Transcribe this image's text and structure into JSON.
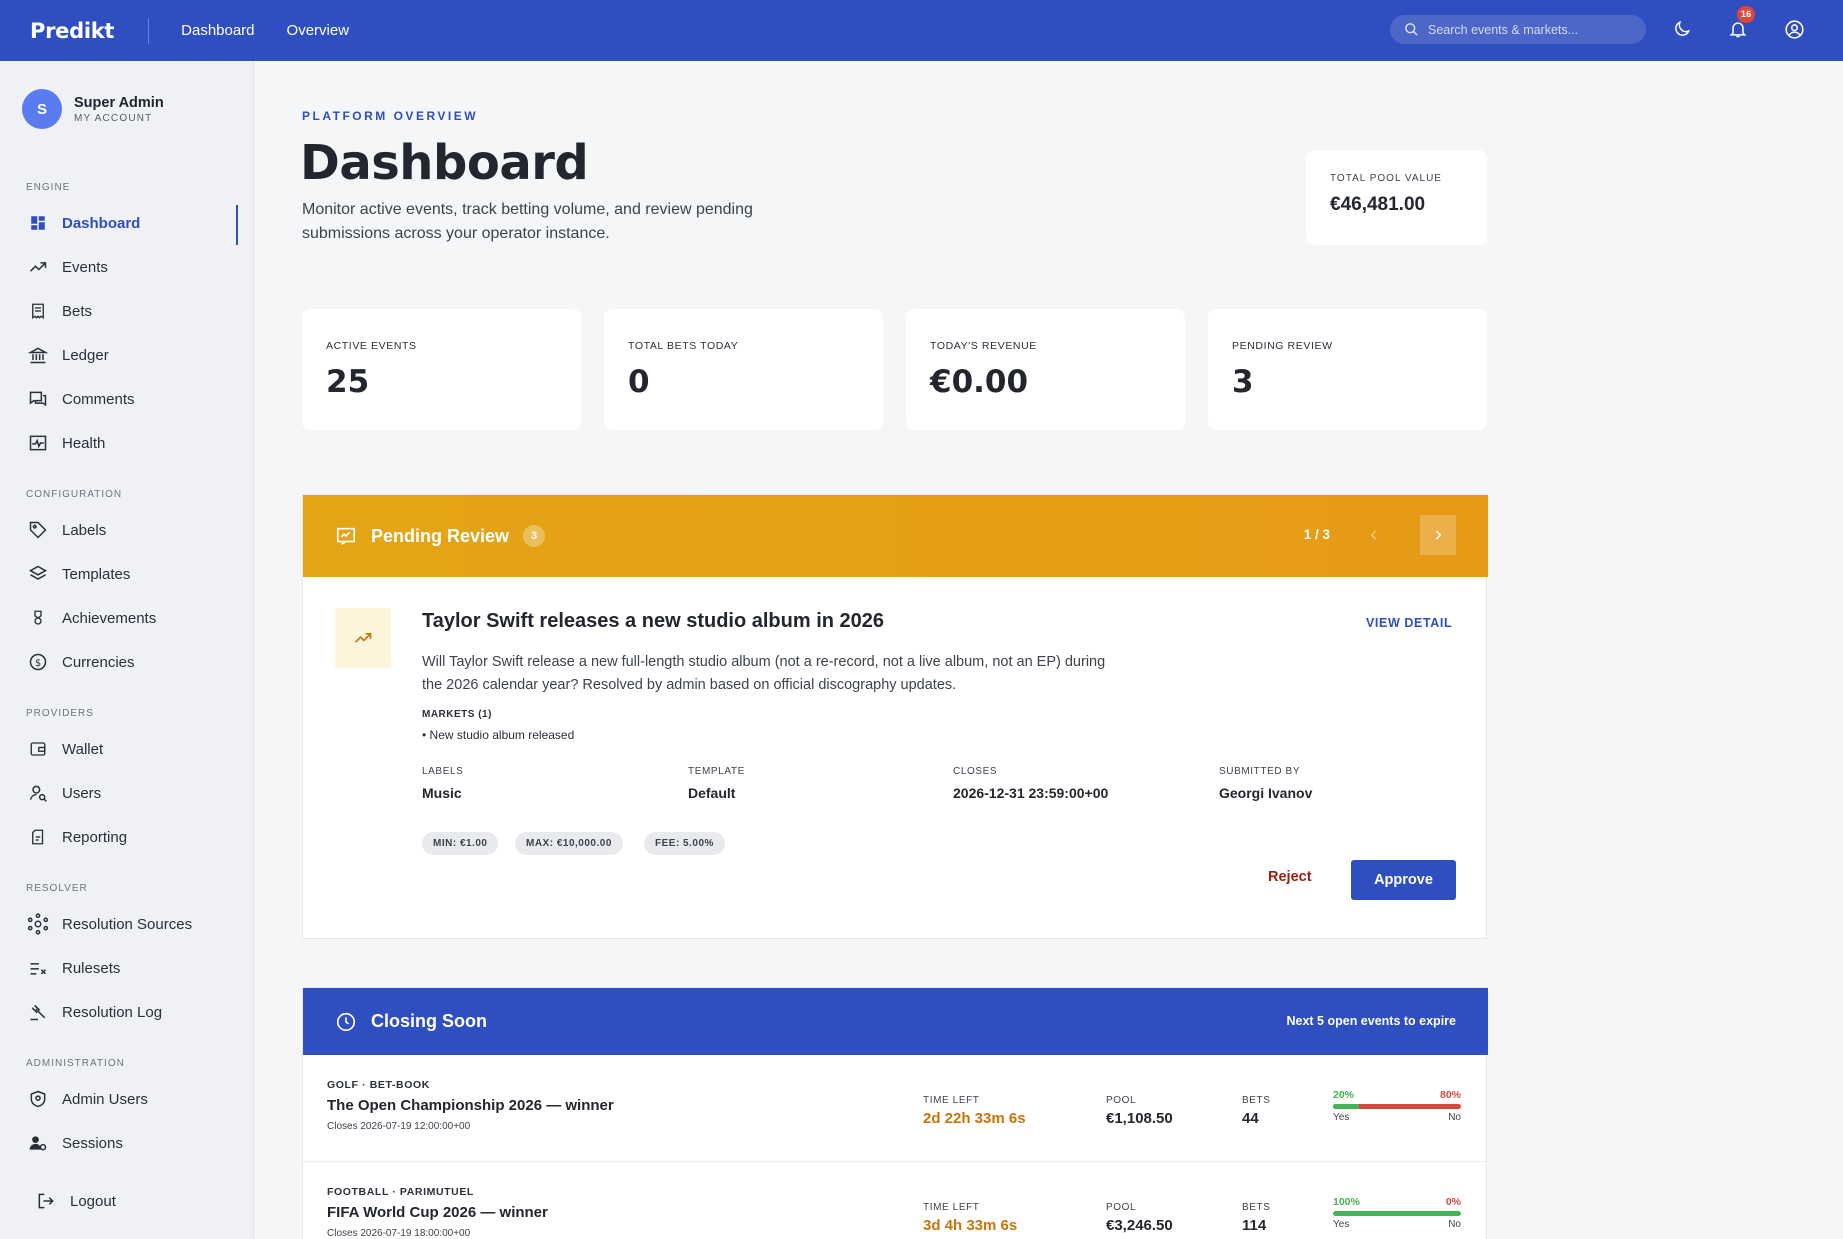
{
  "topbar": {
    "brand": "Predikt",
    "nav": [
      "Dashboard",
      "Overview"
    ],
    "search_placeholder": "Search events & markets...",
    "notification_count": "16",
    "icons": [
      "search-icon",
      "moon-icon",
      "bell-icon",
      "account-circle-icon"
    ]
  },
  "account": {
    "initial": "S",
    "name": "Super Admin",
    "subtitle": "MY ACCOUNT"
  },
  "sidebar": {
    "sections": {
      "engine": "ENGINE",
      "configuration": "CONFIGURATION",
      "providers": "PROVIDERS",
      "resolver": "RESOLVER",
      "administration": "ADMINISTRATION"
    },
    "items": [
      {
        "label": "Dashboard",
        "icon": "dashboard-grid-icon",
        "active": true
      },
      {
        "label": "Events",
        "icon": "trending-up-icon"
      },
      {
        "label": "Bets",
        "icon": "receipt-icon"
      },
      {
        "label": "Ledger",
        "icon": "bank-icon"
      },
      {
        "label": "Comments",
        "icon": "comments-icon"
      },
      {
        "label": "Health",
        "icon": "health-monitor-icon"
      },
      {
        "label": "Labels",
        "icon": "tag-icon"
      },
      {
        "label": "Templates",
        "icon": "layers-icon"
      },
      {
        "label": "Achievements",
        "icon": "medal-icon"
      },
      {
        "label": "Currencies",
        "icon": "currency-exchange-icon"
      },
      {
        "label": "Wallet",
        "icon": "wallet-icon"
      },
      {
        "label": "Users",
        "icon": "user-search-icon"
      },
      {
        "label": "Reporting",
        "icon": "report-icon"
      },
      {
        "label": "Resolution Sources",
        "icon": "hub-icon"
      },
      {
        "label": "Rulesets",
        "icon": "rule-icon"
      },
      {
        "label": "Resolution Log",
        "icon": "gavel-icon"
      },
      {
        "label": "Admin Users",
        "icon": "admin-shield-icon"
      },
      {
        "label": "Sessions",
        "icon": "sessions-icon"
      }
    ],
    "logout": "Logout"
  },
  "header": {
    "kicker": "PLATFORM OVERVIEW",
    "title": "Dashboard",
    "description": "Monitor active events, track betting volume, and review pending submissions across your operator instance.",
    "pool_label": "TOTAL POOL VALUE",
    "pool_value": "€46,481.00"
  },
  "stats": [
    {
      "label": "ACTIVE EVENTS",
      "value": "25"
    },
    {
      "label": "TOTAL BETS TODAY",
      "value": "0"
    },
    {
      "label": "TODAY'S REVENUE",
      "value": "€0.00"
    },
    {
      "label": "PENDING REVIEW",
      "value": "3"
    }
  ],
  "pending": {
    "title": "Pending Review",
    "count": "3",
    "pager": "1 / 3",
    "event": {
      "title": "Taylor Swift releases a new studio album in 2026",
      "description": "Will Taylor Swift release a new full-length studio album (not a re-record, not a live album, not an EP) during the 2026 calendar year? Resolved by admin based on official discography updates.",
      "view_detail": "VIEW DETAIL",
      "markets_label": "MARKETS (1)",
      "markets": [
        "• New studio album released"
      ],
      "meta": [
        {
          "label": "LABELS",
          "value": "Music"
        },
        {
          "label": "TEMPLATE",
          "value": "Default"
        },
        {
          "label": "CLOSES",
          "value": "2026-12-31 23:59:00+00"
        },
        {
          "label": "SUBMITTED BY",
          "value": "Georgi Ivanov"
        }
      ],
      "chips": [
        "MIN: €1.00",
        "MAX: €10,000.00",
        "FEE: 5.00%"
      ],
      "reject": "Reject",
      "approve": "Approve"
    }
  },
  "closing": {
    "title": "Closing Soon",
    "subtitle": "Next 5 open events to expire",
    "labels": {
      "time": "TIME LEFT",
      "pool": "POOL",
      "bets": "BETS",
      "yes": "Yes",
      "no": "No"
    },
    "rows": [
      {
        "category": "GOLF  · BET-BOOK",
        "title": "The Open Championship 2026 — winner",
        "closes": "Closes 2026-07-19 12:00:00+00",
        "time_left": "2d 22h 33m 6s",
        "pool": "€1,108.50",
        "bets": "44",
        "yes_pct_label": "20%",
        "no_pct_label": "80%",
        "yes_fraction": 0.2
      },
      {
        "category": "FOOTBALL  · PARIMUTUEL",
        "title": "FIFA World Cup 2026 — winner",
        "closes": "Closes 2026-07-19 18:00:00+00",
        "time_left": "3d 4h 33m 6s",
        "pool": "€3,246.50",
        "bets": "114",
        "yes_pct_label": "100%",
        "no_pct_label": "0%",
        "yes_fraction": 1.0
      }
    ]
  },
  "colors": {
    "primary": "#2f4ebf",
    "warning": "#e3a516",
    "danger": "#9e1c12",
    "yes": "#43b356",
    "no": "#d34a3e",
    "time": "#c9740a"
  }
}
